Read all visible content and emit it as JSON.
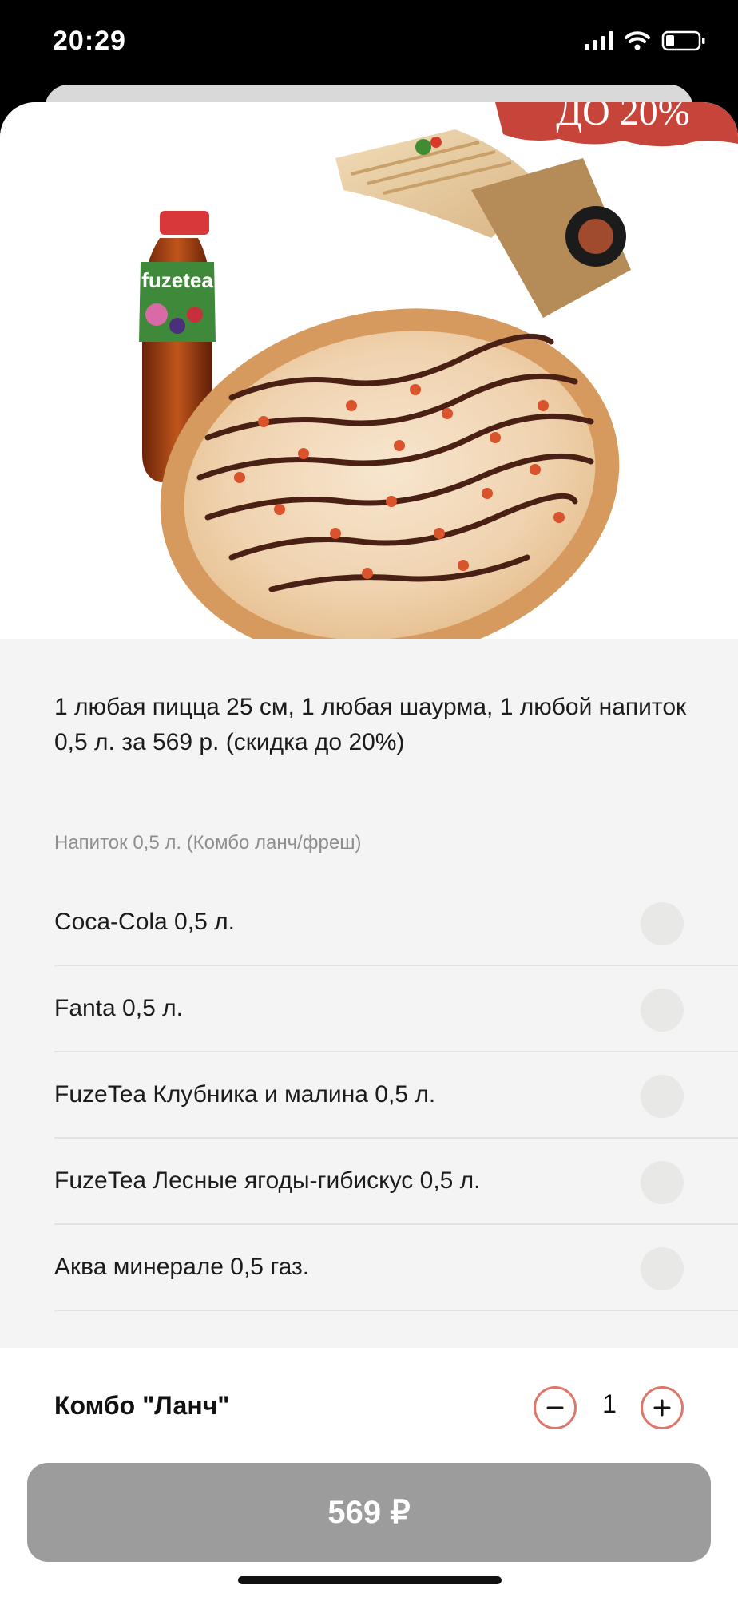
{
  "status_bar": {
    "time": "20:29"
  },
  "hero": {
    "badge_text": "ДО 20%",
    "bottle_brand": "fuzetea"
  },
  "description": "1 любая пицца 25 см, 1 любая шаурма, 1 любой напиток 0,5 л. за 569 р. (скидка до 20%)",
  "options_group": {
    "title": "Напиток 0,5 л. (Комбо ланч/фреш)",
    "items": [
      {
        "label": "Coca-Cola 0,5 л."
      },
      {
        "label": "Fanta 0,5 л."
      },
      {
        "label": "FuzeTea Клубника и малина 0,5 л."
      },
      {
        "label": "FuzeTea Лесные ягоды-гибискус 0,5 л."
      },
      {
        "label": "Аква минерале 0,5 газ."
      }
    ]
  },
  "bottom": {
    "product_name": "Комбо \"Ланч\"",
    "quantity": "1",
    "price_label": "569 ₽"
  },
  "colors": {
    "accent": "#e0756a",
    "button_disabled": "#9c9c9c",
    "sheet_bg": "#f4f4f4"
  }
}
